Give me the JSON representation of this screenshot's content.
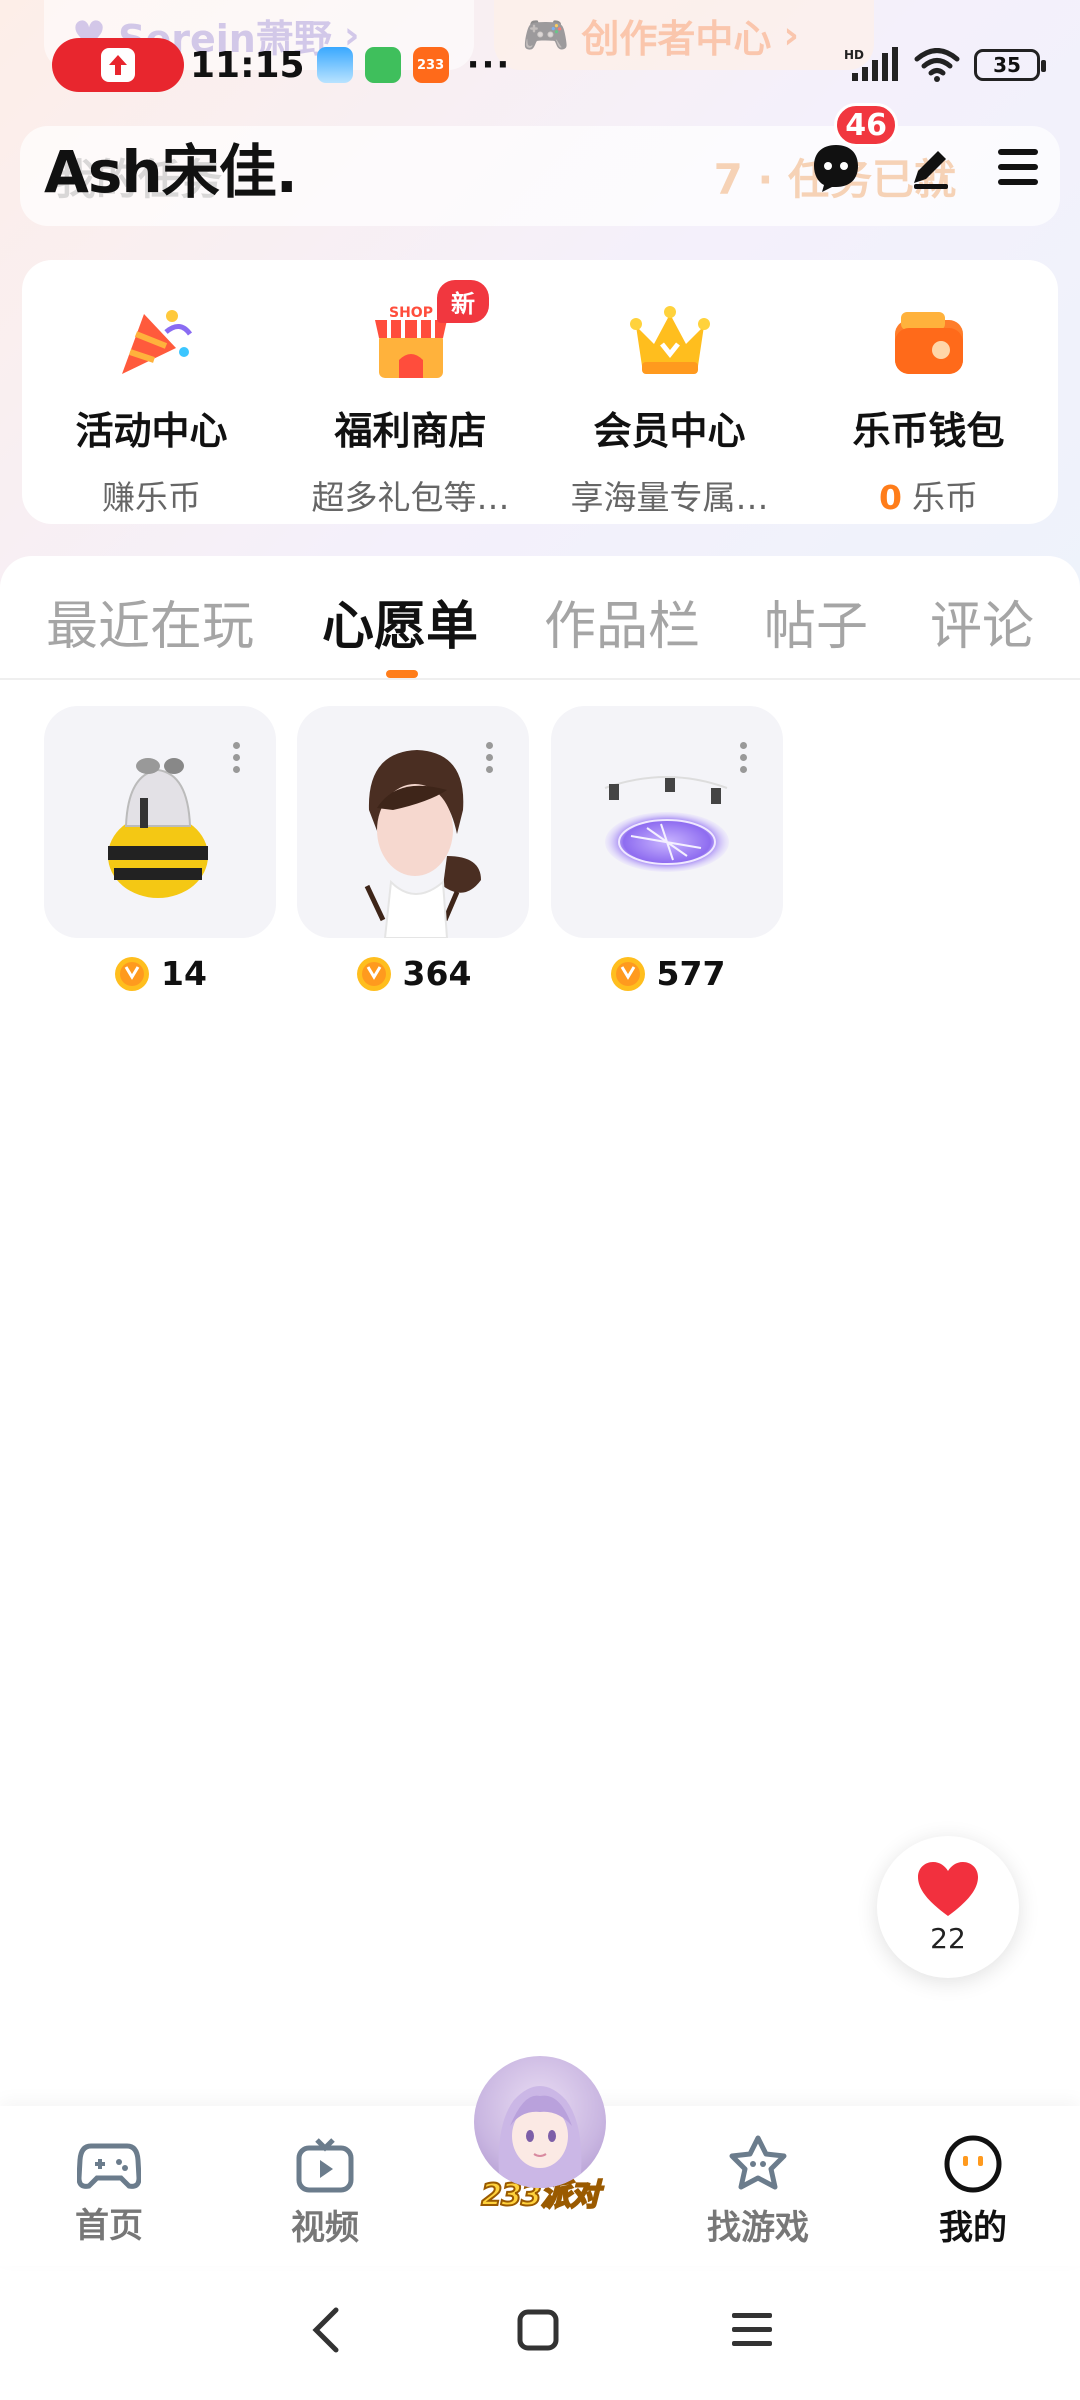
{
  "ghost": {
    "chip_left": "Serein萧野",
    "chip_right": "创作者中心",
    "task_left": "我的任务",
    "task_right": "7 · 任务已就"
  },
  "status_bar": {
    "time": "11:15",
    "app3_label": "233",
    "more": "···",
    "network": "HD",
    "battery": "35"
  },
  "header": {
    "username": "Ash宋佳.",
    "message_badge": "46",
    "icons": [
      "message-icon",
      "edit-icon",
      "menu-icon"
    ]
  },
  "services": [
    {
      "title": "活动中心",
      "subtitle": "赚乐币",
      "icon": "party-popper-icon"
    },
    {
      "title": "福利商店",
      "subtitle": "超多礼包等…",
      "icon": "shop-icon",
      "badge": "新"
    },
    {
      "title": "会员中心",
      "subtitle": "享海量专属…",
      "icon": "crown-icon"
    },
    {
      "title": "乐币钱包",
      "subtitle_num": "0",
      "subtitle": "乐币",
      "icon": "wallet-icon"
    }
  ],
  "tabs": [
    {
      "label": "最近在玩",
      "active": false
    },
    {
      "label": "心愿单",
      "active": true
    },
    {
      "label": "作品栏",
      "active": false
    },
    {
      "label": "帖子",
      "active": false
    },
    {
      "label": "评论",
      "active": false
    }
  ],
  "wishlist": [
    {
      "name": "bee-costume-item",
      "price": "14"
    },
    {
      "name": "hairstyle-item",
      "price": "364"
    },
    {
      "name": "magic-circle-item",
      "price": "577"
    }
  ],
  "fab": {
    "count": "22",
    "icon": "heart-icon"
  },
  "bottom_nav": [
    {
      "label": "首页",
      "icon": "gamepad-icon",
      "active": false
    },
    {
      "label": "视频",
      "icon": "tv-icon",
      "active": false
    },
    {
      "label": "233派对",
      "icon": "party-avatar-icon",
      "active": false
    },
    {
      "label": "找游戏",
      "icon": "star-icon",
      "active": false
    },
    {
      "label": "我的",
      "icon": "smile-icon",
      "active": true
    }
  ],
  "colors": {
    "accent": "#ff7d1a",
    "badge": "#f1373f",
    "heart": "#f2303e"
  }
}
